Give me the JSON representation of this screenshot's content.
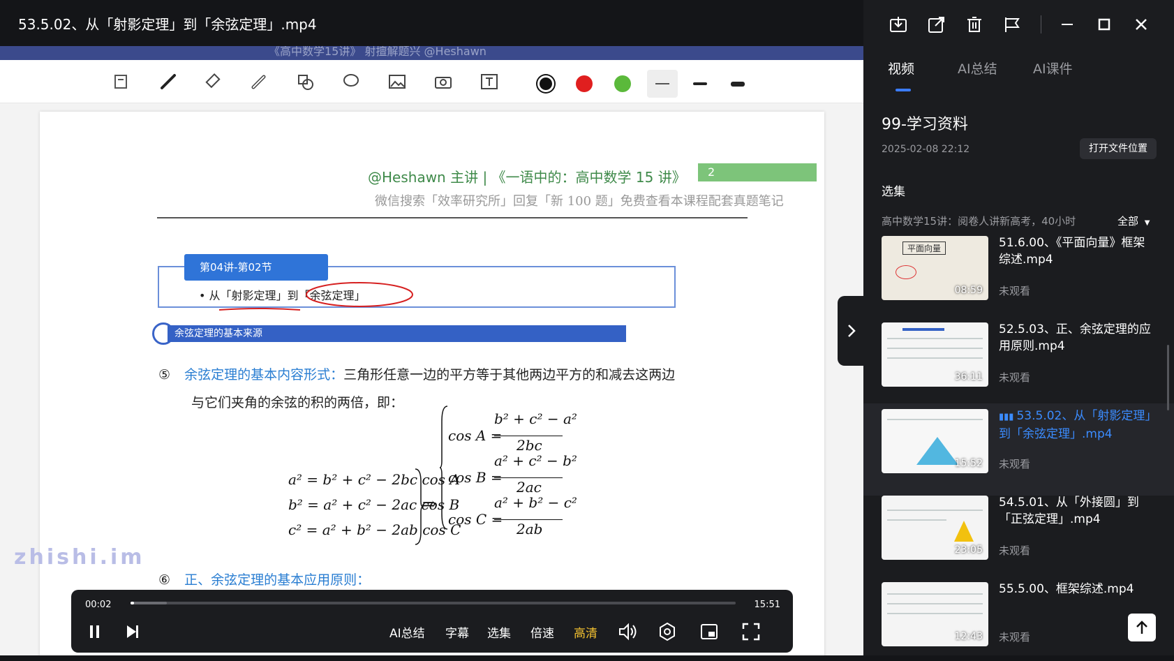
{
  "window": {
    "title": "53.5.02、从「射影定理」到「余弦定理」.mp4"
  },
  "app_band": {
    "ghost_title": "《高中数学15讲》 射擅解题兴 @Heshawn"
  },
  "slide": {
    "header": "@Heshawn 主讲 | 《一语中的：高中数学 15 讲》",
    "page_number": "2",
    "subheader": "微信搜索「效率研究所」回复「新 100 题」免费查看本课程配套真题笔记",
    "section_tab": "第04讲-第02节",
    "section_item": "• 从「射影定理」到「余弦定理」",
    "blue_bar": "余弦定理的基本来源",
    "p5_num": "⑤",
    "p5_blue": "余弦定理的基本内容形式：",
    "p5_text": "三角形任意一边的平方等于其他两边平方的和减去这两边",
    "p5_text2": "与它们夹角的余弦的积的两倍，即：",
    "eq1": "a² = b² + c² − 2bc cos A",
    "eq2": "b² = a² + c² − 2ac cos B",
    "eq3": "c² = a² + b² − 2ab cos C",
    "arrow": "⇒",
    "cosA_l": "cos A =",
    "cosA_n": "b² + c² − a²",
    "cosA_d": "2bc",
    "cosB_l": "cos B =",
    "cosB_n": "a² + c² − b²",
    "cosB_d": "2ac",
    "cosC_l": "cos C =",
    "cosC_n": "a² + b² − c²",
    "cosC_d": "2ab",
    "p6_num": "⑥",
    "p6_blue": "正、余弦定理的基本应用原则："
  },
  "watermark": "zhishi.im",
  "player": {
    "current_time": "00:02",
    "duration": "15:51",
    "progress": 0.006,
    "buffer": 0.06,
    "labels": {
      "ai_summary": "AI总结",
      "subtitle": "字幕",
      "episodes": "选集",
      "speed": "倍速",
      "quality": "高清"
    },
    "quality_color": "#f5c230"
  },
  "panel": {
    "tabs": [
      "视频",
      "AI总结",
      "AI课件"
    ],
    "active_tab": 0,
    "title": "99-学习资料",
    "date": "2025-02-08 22:12",
    "open_location": "打开文件位置",
    "episodes_label": "选集",
    "collection": "高中数学15讲：阅卷人讲新高考，40小时",
    "all": "全部",
    "items": [
      {
        "title": "51.6.00、《平面向量》框架综述.mp4",
        "status": "未观看",
        "duration": "08:59"
      },
      {
        "title": "52.5.03、正、余弦定理的应用原则.mp4",
        "status": "未观看",
        "duration": "36:11"
      },
      {
        "title": "53.5.02、从「射影定理」到「余弦定理」.mp4",
        "status": "未观看",
        "duration": "15:52",
        "playing": true
      },
      {
        "title": "54.5.01、从「外接圆」到「正弦定理」.mp4",
        "status": "未观看",
        "duration": "23:05"
      },
      {
        "title": "55.5.00、框架综述.mp4",
        "status": "未观看",
        "duration": "12:43"
      }
    ]
  },
  "colors": {
    "accent": "#3b7cff",
    "active_item": "#3b8cff",
    "panel_bg": "#1b1c1f"
  }
}
